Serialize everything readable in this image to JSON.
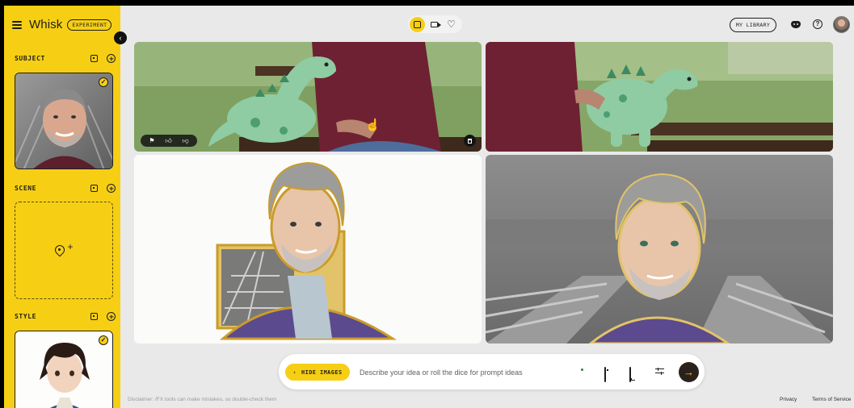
{
  "app": {
    "name": "Whisk",
    "badge": "EXPERIMENT"
  },
  "sidebar": {
    "sections": [
      {
        "label": "SUBJECT",
        "selected": true
      },
      {
        "label": "SCENE",
        "selected": false
      },
      {
        "label": "STYLE",
        "selected": true
      }
    ]
  },
  "topbar": {
    "modes": [
      {
        "icon": "image-mode-icon",
        "active": true
      },
      {
        "icon": "video-mode-icon",
        "active": false
      },
      {
        "icon": "heart-icon",
        "active": false
      }
    ],
    "library_label": "MY LIBRARY",
    "icons": [
      "discord-icon",
      "help-icon",
      "profile-avatar"
    ]
  },
  "gallery": {
    "tiles": [
      {
        "description": "man in maroon polo holding green plush dinosaur on park bench",
        "toolbar": [
          "flag-icon",
          "thumbs-up-icon",
          "thumbs-down-icon"
        ],
        "delete_icon": "trash-icon"
      },
      {
        "description": "man in maroon polo holding green plush dinosaur on park bench, close crop"
      },
      {
        "description": "enamel pin illustration of gray-haired man with railway tracks"
      },
      {
        "description": "illustrated portrait of gray-haired man over blurred railway tracks"
      }
    ]
  },
  "prompt": {
    "hide_label": "HIDE IMAGES",
    "placeholder": "Describe your idea or roll the dice for prompt ideas",
    "value": ""
  },
  "footer": {
    "disclaimer": "Disclaimer: /FX tools can make mistakes, so double-check them",
    "privacy": "Privacy",
    "terms": "Terms of Service"
  },
  "colors": {
    "accent": "#f6cf14",
    "background": "#e9e9e9",
    "send_button": "#2a211c"
  }
}
